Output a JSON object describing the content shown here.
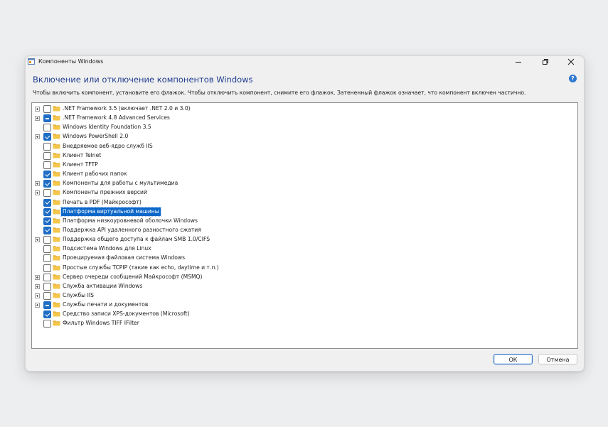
{
  "window": {
    "title": "Компоненты Windows",
    "heading": "Включение или отключение компонентов Windows",
    "description": "Чтобы включить компонент, установите его флажок. Чтобы отключить компонент, снимите его флажок. Затененный флажок означает, что компонент включен частично.",
    "help_glyph": "?"
  },
  "colors": {
    "accent": "#1f6dc4",
    "heading": "#1f3d8f",
    "selection": "#0c67c9",
    "folder": "#f4c64b"
  },
  "features": [
    {
      "label": ".NET Framework 3.5 (включает .NET 2.0 и 3.0)",
      "state": "unchecked",
      "expandable": true,
      "selected": false
    },
    {
      "label": ".NET Framework 4.8 Advanced Services",
      "state": "partial",
      "expandable": true,
      "selected": false
    },
    {
      "label": "Windows Identity Foundation 3.5",
      "state": "unchecked",
      "expandable": false,
      "selected": false
    },
    {
      "label": "Windows PowerShell 2.0",
      "state": "checked",
      "expandable": true,
      "selected": false
    },
    {
      "label": "Внедряемое веб-ядро служб IIS",
      "state": "unchecked",
      "expandable": false,
      "selected": false
    },
    {
      "label": "Клиент Telnet",
      "state": "unchecked",
      "expandable": false,
      "selected": false
    },
    {
      "label": "Клиент TFTP",
      "state": "unchecked",
      "expandable": false,
      "selected": false
    },
    {
      "label": "Клиент рабочих папок",
      "state": "checked",
      "expandable": false,
      "selected": false
    },
    {
      "label": "Компоненты для работы с мультимедиа",
      "state": "checked",
      "expandable": true,
      "selected": false
    },
    {
      "label": "Компоненты прежних версий",
      "state": "unchecked",
      "expandable": true,
      "selected": false
    },
    {
      "label": "Печать в PDF (Майкрософт)",
      "state": "checked",
      "expandable": false,
      "selected": false
    },
    {
      "label": "Платформа виртуальной машины",
      "state": "checked",
      "expandable": false,
      "selected": true
    },
    {
      "label": "Платформа низкоуровневой оболочки Windows",
      "state": "checked",
      "expandable": false,
      "selected": false
    },
    {
      "label": "Поддержка API удаленного разностного сжатия",
      "state": "checked",
      "expandable": false,
      "selected": false
    },
    {
      "label": "Поддержка общего доступа к файлам SMB 1.0/CIFS",
      "state": "unchecked",
      "expandable": true,
      "selected": false
    },
    {
      "label": "Подсистема Windows для Linux",
      "state": "unchecked",
      "expandable": false,
      "selected": false
    },
    {
      "label": "Проецируемая файловая система Windows",
      "state": "unchecked",
      "expandable": false,
      "selected": false
    },
    {
      "label": "Простые службы TCPIP (такие как echo, daytime и т.п.)",
      "state": "unchecked",
      "expandable": false,
      "selected": false
    },
    {
      "label": "Сервер очереди сообщений Майкрософт (MSMQ)",
      "state": "unchecked",
      "expandable": true,
      "selected": false
    },
    {
      "label": "Служба активации Windows",
      "state": "unchecked",
      "expandable": true,
      "selected": false
    },
    {
      "label": "Службы IIS",
      "state": "unchecked",
      "expandable": true,
      "selected": false
    },
    {
      "label": "Службы печати и документов",
      "state": "partial",
      "expandable": true,
      "selected": false
    },
    {
      "label": "Средство записи XPS-документов (Microsoft)",
      "state": "checked",
      "expandable": false,
      "selected": false
    },
    {
      "label": "Фильтр Windows TIFF IFilter",
      "state": "unchecked",
      "expandable": false,
      "selected": false
    }
  ],
  "buttons": {
    "ok": "ОК",
    "cancel": "Отмена"
  }
}
